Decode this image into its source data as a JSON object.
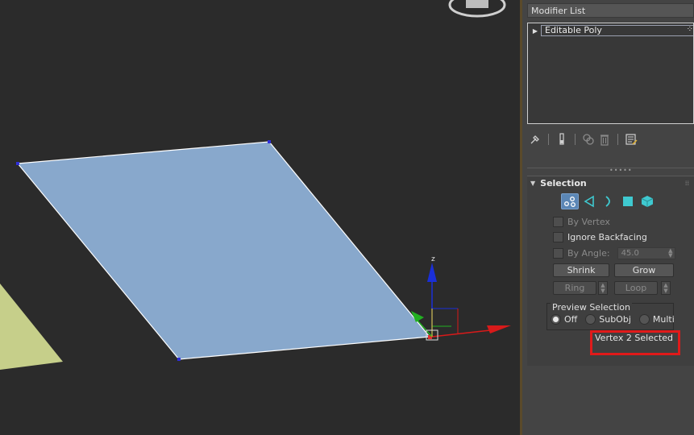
{
  "app": {
    "panel": {
      "modifier_list_label": "Modifier List",
      "stack": [
        {
          "label": "Editable Poly",
          "selected": true
        }
      ]
    },
    "toolbar_icons": [
      "pin-icon",
      "show-end-result-icon",
      "make-unique-icon",
      "remove-modifier-icon",
      "configure-modifier-sets-icon"
    ],
    "selection_rollout": {
      "title": "Selection",
      "subobject_levels": [
        {
          "icon": "vertex-icon",
          "active": true
        },
        {
          "icon": "edge-icon",
          "active": false
        },
        {
          "icon": "border-icon",
          "active": false
        },
        {
          "icon": "polygon-icon",
          "active": false
        },
        {
          "icon": "element-icon",
          "active": false
        }
      ],
      "by_vertex_label": "By Vertex",
      "ignore_backfacing_label": "Ignore Backfacing",
      "by_angle_label": "By Angle:",
      "by_angle_value": "45.0",
      "shrink_label": "Shrink",
      "grow_label": "Grow",
      "ring_label": "Ring",
      "loop_label": "Loop",
      "preview_selection": {
        "title": "Preview Selection",
        "options": [
          "Off",
          "SubObj",
          "Multi"
        ],
        "selected": "Off"
      },
      "status_text": "Vertex 2 Selected"
    },
    "viewport": {
      "axis_z_label": "z",
      "plane_color": "#88a8cc",
      "other_object_color": "#c6cf8a",
      "vertex_color": "#2f2fd8"
    }
  }
}
